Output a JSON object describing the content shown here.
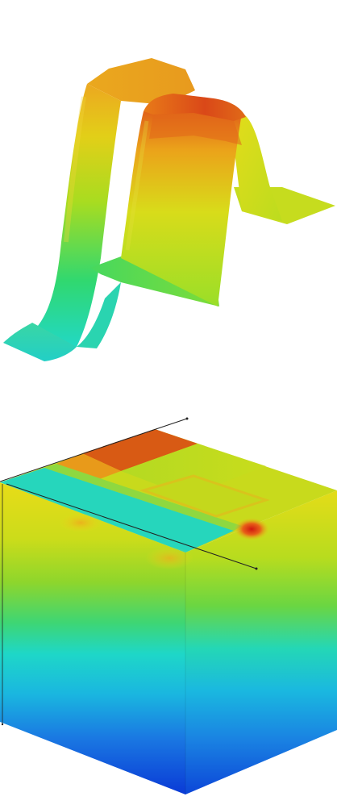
{
  "scene": {
    "background": "#ffffff",
    "colormap": [
      "#0a36d6",
      "#1a8ee0",
      "#20d8c8",
      "#38d860",
      "#c8e020",
      "#e8d218",
      "#ea9a18",
      "#d83a18"
    ],
    "panels": [
      {
        "name": "surface-plot-top",
        "kind": "3d-surface"
      },
      {
        "name": "cube-plot-bottom",
        "kind": "3d-block"
      }
    ]
  }
}
